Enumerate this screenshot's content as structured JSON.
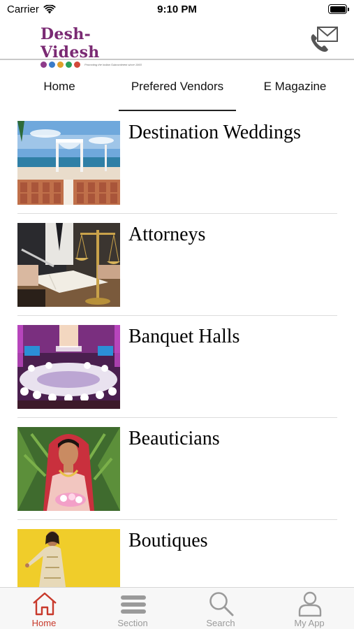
{
  "status_bar": {
    "carrier": "Carrier",
    "time": "9:10 PM"
  },
  "header": {
    "logo_text": "Desh-Videsh",
    "logo_tagline": "Promoting the Indian Subcontinent since 1993",
    "logo_dot_colors": [
      "#8e3b8a",
      "#3a7bc8",
      "#e0a02a",
      "#2aa05a",
      "#d24a3a"
    ],
    "contact_icon": "phone-mail-icon"
  },
  "tabs": [
    {
      "label": "Home",
      "active": false
    },
    {
      "label": "Prefered Vendors",
      "active": true
    },
    {
      "label": "E Magazine",
      "active": false
    }
  ],
  "vendors": [
    {
      "name": "Destination Weddings",
      "image": "beach-wedding-image"
    },
    {
      "name": "Attorneys",
      "image": "scales-of-justice-image"
    },
    {
      "name": "Banquet Halls",
      "image": "banquet-hall-image"
    },
    {
      "name": "Beauticians",
      "image": "bride-portrait-image"
    },
    {
      "name": "Boutiques",
      "image": "boutique-model-image"
    }
  ],
  "tab_bar": [
    {
      "label": "Home",
      "icon": "home-icon",
      "active": true
    },
    {
      "label": "Section",
      "icon": "menu-icon",
      "active": false
    },
    {
      "label": "Search",
      "icon": "search-icon",
      "active": false
    },
    {
      "label": "My App",
      "icon": "person-icon",
      "active": false
    }
  ],
  "colors": {
    "accent": "#c8392b",
    "inactive": "#9a9a9a",
    "logo": "#7a2a73"
  }
}
